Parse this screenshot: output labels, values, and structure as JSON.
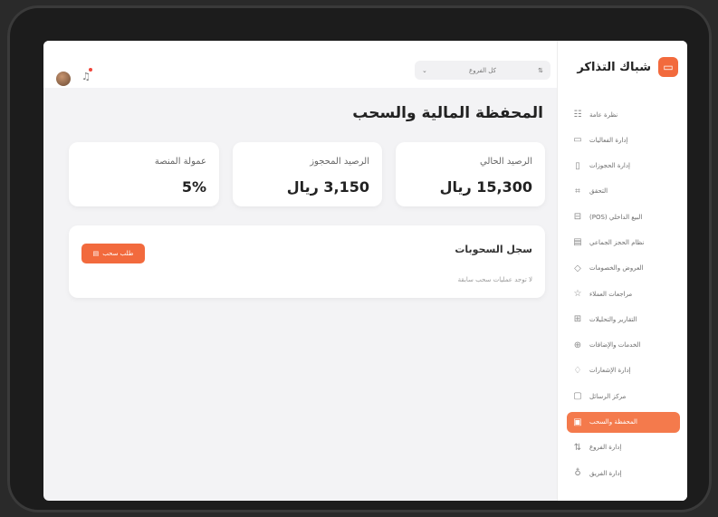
{
  "brand": {
    "name": "شباك التذاكر",
    "logo_icon": "ticket-icon"
  },
  "sidebar": {
    "items": [
      {
        "label": "نظرة عامة",
        "icon": "dashboard-icon",
        "glyph": "☷",
        "active": false
      },
      {
        "label": "إدارة الفعاليات",
        "icon": "ticket-icon",
        "glyph": "▭",
        "active": false
      },
      {
        "label": "إدارة الحجوزات",
        "icon": "clipboard-icon",
        "glyph": "▯",
        "active": false
      },
      {
        "label": "التحقق",
        "icon": "scan-icon",
        "glyph": "⌗",
        "active": false
      },
      {
        "label": "البيع الداخلي (POS)",
        "icon": "pos-icon",
        "glyph": "⊟",
        "active": false
      },
      {
        "label": "نظام الحجز الجماعي",
        "icon": "group-booking-icon",
        "glyph": "▤",
        "active": false
      },
      {
        "label": "العروض والخصومات",
        "icon": "tag-icon",
        "glyph": "◇",
        "active": false
      },
      {
        "label": "مراجعات العملاء",
        "icon": "star-icon",
        "glyph": "☆",
        "active": false
      },
      {
        "label": "التقارير والتحليلات",
        "icon": "chart-icon",
        "glyph": "⊞",
        "active": false
      },
      {
        "label": "الخدمات والإضافات",
        "icon": "addons-icon",
        "glyph": "⊕",
        "active": false
      },
      {
        "label": "إدارة الإشعارات",
        "icon": "bell-icon",
        "glyph": "♢",
        "active": false
      },
      {
        "label": "مركز الرسائل",
        "icon": "message-icon",
        "glyph": "▢",
        "active": false
      },
      {
        "label": "المحفظة والسحب",
        "icon": "wallet-icon",
        "glyph": "▣",
        "active": true
      },
      {
        "label": "إدارة الفروع",
        "icon": "branches-icon",
        "glyph": "⇅",
        "active": false
      },
      {
        "label": "إدارة الفريق",
        "icon": "team-icon",
        "glyph": "♁",
        "active": false
      }
    ]
  },
  "topbar": {
    "branch_select": "كل الفروع",
    "branch_chevron": "⌄",
    "branch_icon": "⇅",
    "bell_glyph": "♫",
    "bell_icon": "bell-icon"
  },
  "main": {
    "title": "المحفظة المالية والسحب",
    "stats": [
      {
        "label": "الرصيد الحالي",
        "value": "15,300 ريال"
      },
      {
        "label": "الرصيد المحجوز",
        "value": "3,150 ريال"
      },
      {
        "label": "عمولة المنصة",
        "value": "5%"
      }
    ],
    "history": {
      "title": "سجل السحوبات",
      "empty_text": "لا توجد عمليات سحب سابقة",
      "button_label": "طلب سحب",
      "button_glyph": "▤"
    }
  },
  "colors": {
    "accent": "#f26a3d",
    "active_nav": "#f47a4c"
  }
}
